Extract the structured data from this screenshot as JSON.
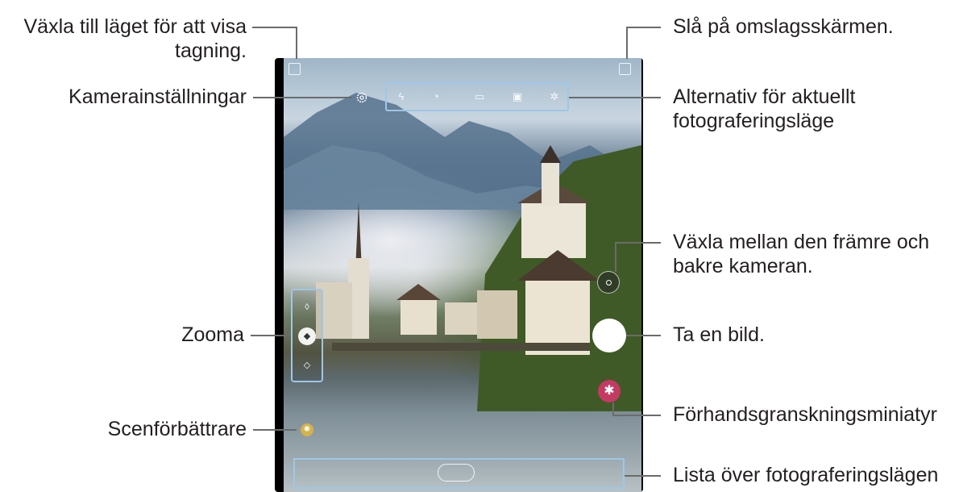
{
  "callouts": {
    "view_mode": "Växla till läget för att visa\ntagning.",
    "view_mode_line1": "Växla till läget för att visa",
    "view_mode_line2": "tagning.",
    "settings": "Kamerainställningar",
    "zoom": "Zooma",
    "scene": "Scenförbättrare",
    "cover_screen": "Slå på omslagsskärmen.",
    "options_line1": "Alternativ för aktuellt",
    "options_line2": "fotograferingsläge",
    "switch_line1": "Växla mellan den främre och",
    "switch_line2": "bakre kameran.",
    "shutter": "Ta en bild.",
    "preview": "Förhandsgranskningsminiatyr",
    "modes": "Lista över fotograferingslägen"
  },
  "colors": {
    "callout_box": "#9fc7e7",
    "thumbnail": "#c43a63",
    "shutter": "#ffffff"
  },
  "icons": {
    "settings": "gear-icon",
    "view_mode": "screen-mode-icon",
    "cover_screen": "cover-screen-icon",
    "options": [
      "flash-icon",
      "timer-icon",
      "ratio-icon",
      "motion-photo-icon",
      "filter-icon"
    ],
    "zoom": [
      "ultra-wide-icon",
      "wide-icon",
      "telephoto-icon"
    ],
    "switch_camera": "switch-camera-icon",
    "scene": "scene-optimizer-icon",
    "thumbnail": "preview-thumbnail-icon"
  }
}
